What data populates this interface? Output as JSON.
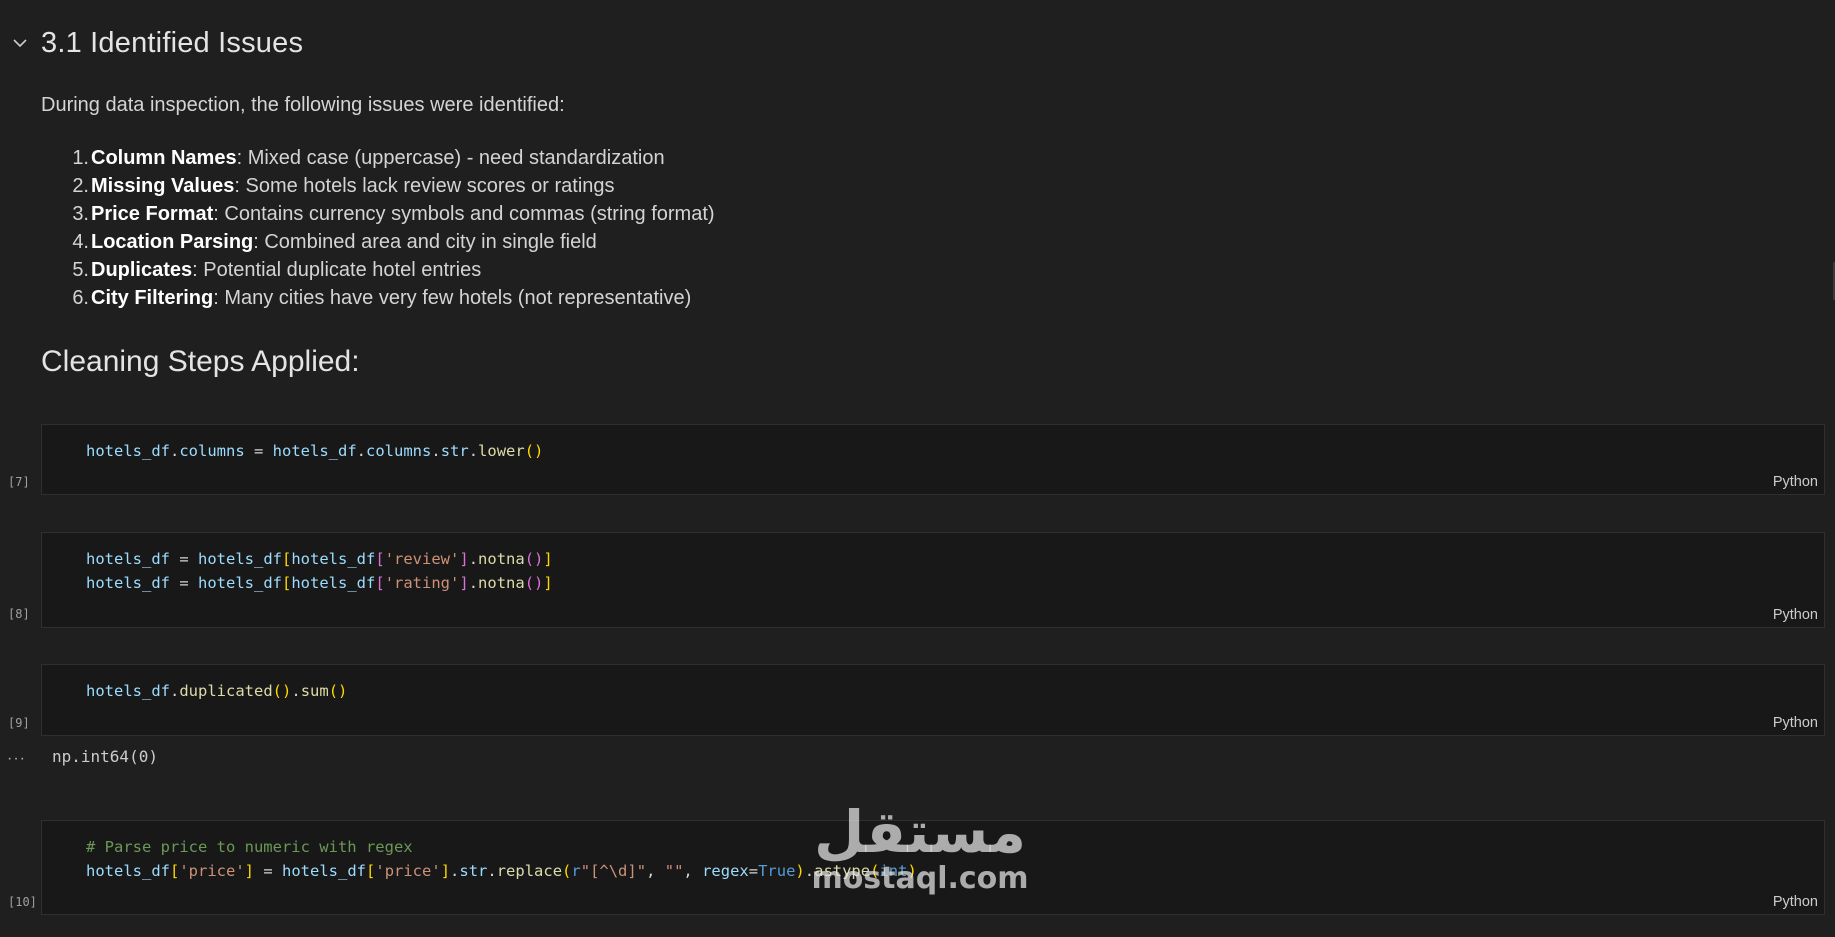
{
  "heading": "3.1 Identified Issues",
  "intro": "During data inspection, the following issues were identified:",
  "issues": [
    {
      "num": "1.",
      "title": "Column Names",
      "desc": ": Mixed case (uppercase) - need standardization"
    },
    {
      "num": "2.",
      "title": "Missing Values",
      "desc": ": Some hotels lack review scores or ratings"
    },
    {
      "num": "3.",
      "title": "Price Format",
      "desc": ": Contains currency symbols and commas (string format)"
    },
    {
      "num": "4.",
      "title": "Location Parsing",
      "desc": ": Combined area and city in single field"
    },
    {
      "num": "5.",
      "title": "Duplicates",
      "desc": ": Potential duplicate hotel entries"
    },
    {
      "num": "6.",
      "title": "City Filtering",
      "desc": ": Many cities have very few hotels (not representative)"
    }
  ],
  "subheading": "Cleaning Steps Applied:",
  "cells": [
    {
      "exec": "[7]",
      "lang": "Python"
    },
    {
      "exec": "[8]",
      "lang": "Python"
    },
    {
      "exec": "[9]",
      "lang": "Python"
    },
    {
      "exec": "[10]",
      "lang": "Python"
    }
  ],
  "code": {
    "hotels_df": "hotels_df",
    "columns": "columns",
    "str": "str",
    "lower": "lower",
    "review_lit": "'review'",
    "rating_lit": "'rating'",
    "price_lit": "'price'",
    "notna": "notna",
    "duplicated": "duplicated",
    "sum": "sum",
    "replace": "replace",
    "astype": "astype",
    "comment": "# Parse price to numeric with regex",
    "r_prefix": "r",
    "regex_pattern": "\"[^\\d]\"",
    "empty_str": "\"\"",
    "regex_kw": "regex",
    "true_kw": "True",
    "int_kw": "int"
  },
  "output_text": "np.int64(0)",
  "output_more": "···",
  "watermark": {
    "arabic": "مستقل",
    "latin": "mostaql.com"
  }
}
